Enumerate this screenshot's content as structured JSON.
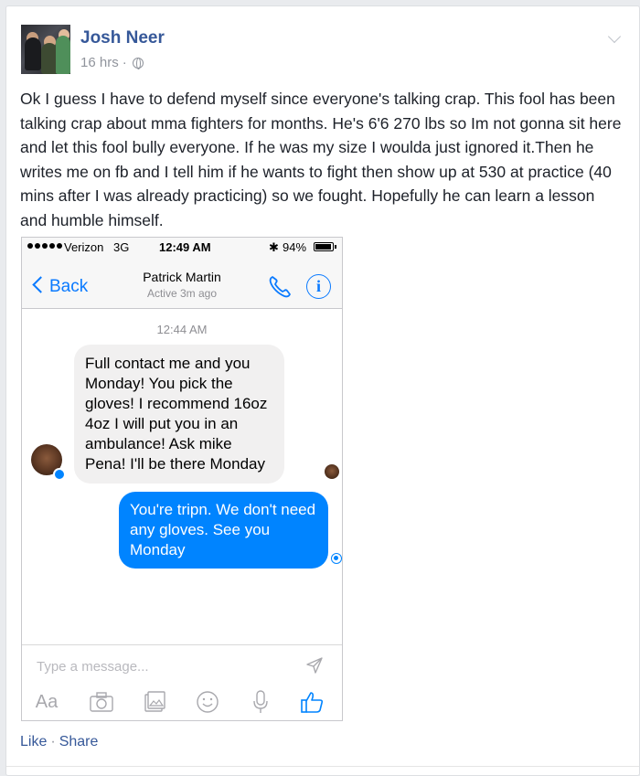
{
  "post": {
    "author": "Josh Neer",
    "time": "16 hrs",
    "separator": "·",
    "text": "Ok I guess I have to defend myself since everyone's talking crap. This fool has been talking crap about mma fighters for months. He's 6'6 270 lbs so Im not gonna sit here and let this fool bully everyone. If he was my size I woulda just ignored it.Then he writes me on fb and I tell him if he wants to fight then show up at 530 at practice (40 mins after I was already practicing) so we fought. Hopefully he can learn a lesson and humble himself.",
    "actions": {
      "like": "Like",
      "separator": "·",
      "share": "Share"
    }
  },
  "screenshot": {
    "status_bar": {
      "carrier": "Verizon",
      "network": "3G",
      "time": "12:49 AM",
      "battery": "94%",
      "battery_level": 0.94
    },
    "nav": {
      "back_label": "Back",
      "contact_name": "Patrick Martin",
      "contact_status": "Active 3m ago"
    },
    "conversation": {
      "timestamp": "12:44 AM",
      "messages": [
        {
          "direction": "incoming",
          "text": "Full contact me and you Monday! You pick the gloves! I recommend 16oz 4oz I will put you in an ambulance! Ask mike Pena! I'll be there Monday"
        },
        {
          "direction": "outgoing",
          "text": "You're tripn. We don't need any gloves. See you Monday"
        }
      ]
    },
    "composer": {
      "placeholder": "Type a message...",
      "text_tool_label": "Aa"
    }
  },
  "colors": {
    "link_blue": "#365899",
    "ios_blue": "#0a7aff",
    "messenger_blue": "#0084ff",
    "incoming_bubble": "#f1f0f0"
  },
  "icons": [
    "globe-icon",
    "chevron-down-icon",
    "back-chevron-icon",
    "phone-icon",
    "info-icon",
    "messenger-badge-icon",
    "send-icon",
    "camera-icon",
    "gallery-icon",
    "emoji-icon",
    "microphone-icon",
    "thumbs-up-icon"
  ]
}
